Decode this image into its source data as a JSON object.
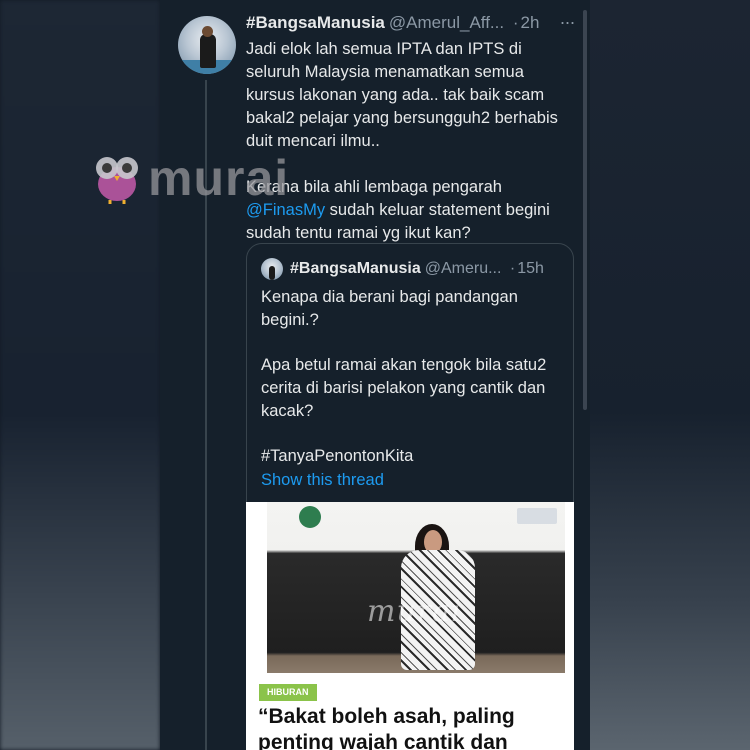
{
  "tweet": {
    "display_name": "#BangsaManusia",
    "handle": "@Amerul_Aff...",
    "separator": "·",
    "time": "2h",
    "more_label": "···",
    "paragraph_1": "Jadi elok lah semua IPTA dan IPTS di seluruh Malaysia menamatkan semua kursus lakonan yang ada.. tak baik scam bakal2 pelajar yang bersungguh2 berhabis duit mencari ilmu..",
    "paragraph_2_before": "Kerana bila ahli lembaga pengarah ",
    "mention": "@FinasMy",
    "paragraph_2_after": " sudah keluar statement begini sudah tentu ramai yg ikut kan?"
  },
  "quote": {
    "display_name": "#BangsaManusia",
    "handle": "@Ameru...",
    "separator": "·",
    "time": "15h",
    "paragraph_1": "Kenapa dia berani bagi pandangan begini.?",
    "paragraph_2": "Apa betul ramai akan tengok bila satu2 cerita di barisi pelakon yang cantik dan kacak?",
    "hashtag": "#TanyaPenontonKita",
    "show_thread": "Show this thread",
    "image": {
      "badge": "HIBURAN",
      "headline": "“Bakat boleh asah, paling penting wajah cantik dan",
      "photo_watermark": "murai"
    }
  },
  "watermark": {
    "text": "murai"
  },
  "colors": {
    "background": "#15202b",
    "text": "#e7e9ea",
    "secondary": "#8b98a5",
    "accent": "#1d9bf0",
    "badge": "#8bc34a"
  }
}
